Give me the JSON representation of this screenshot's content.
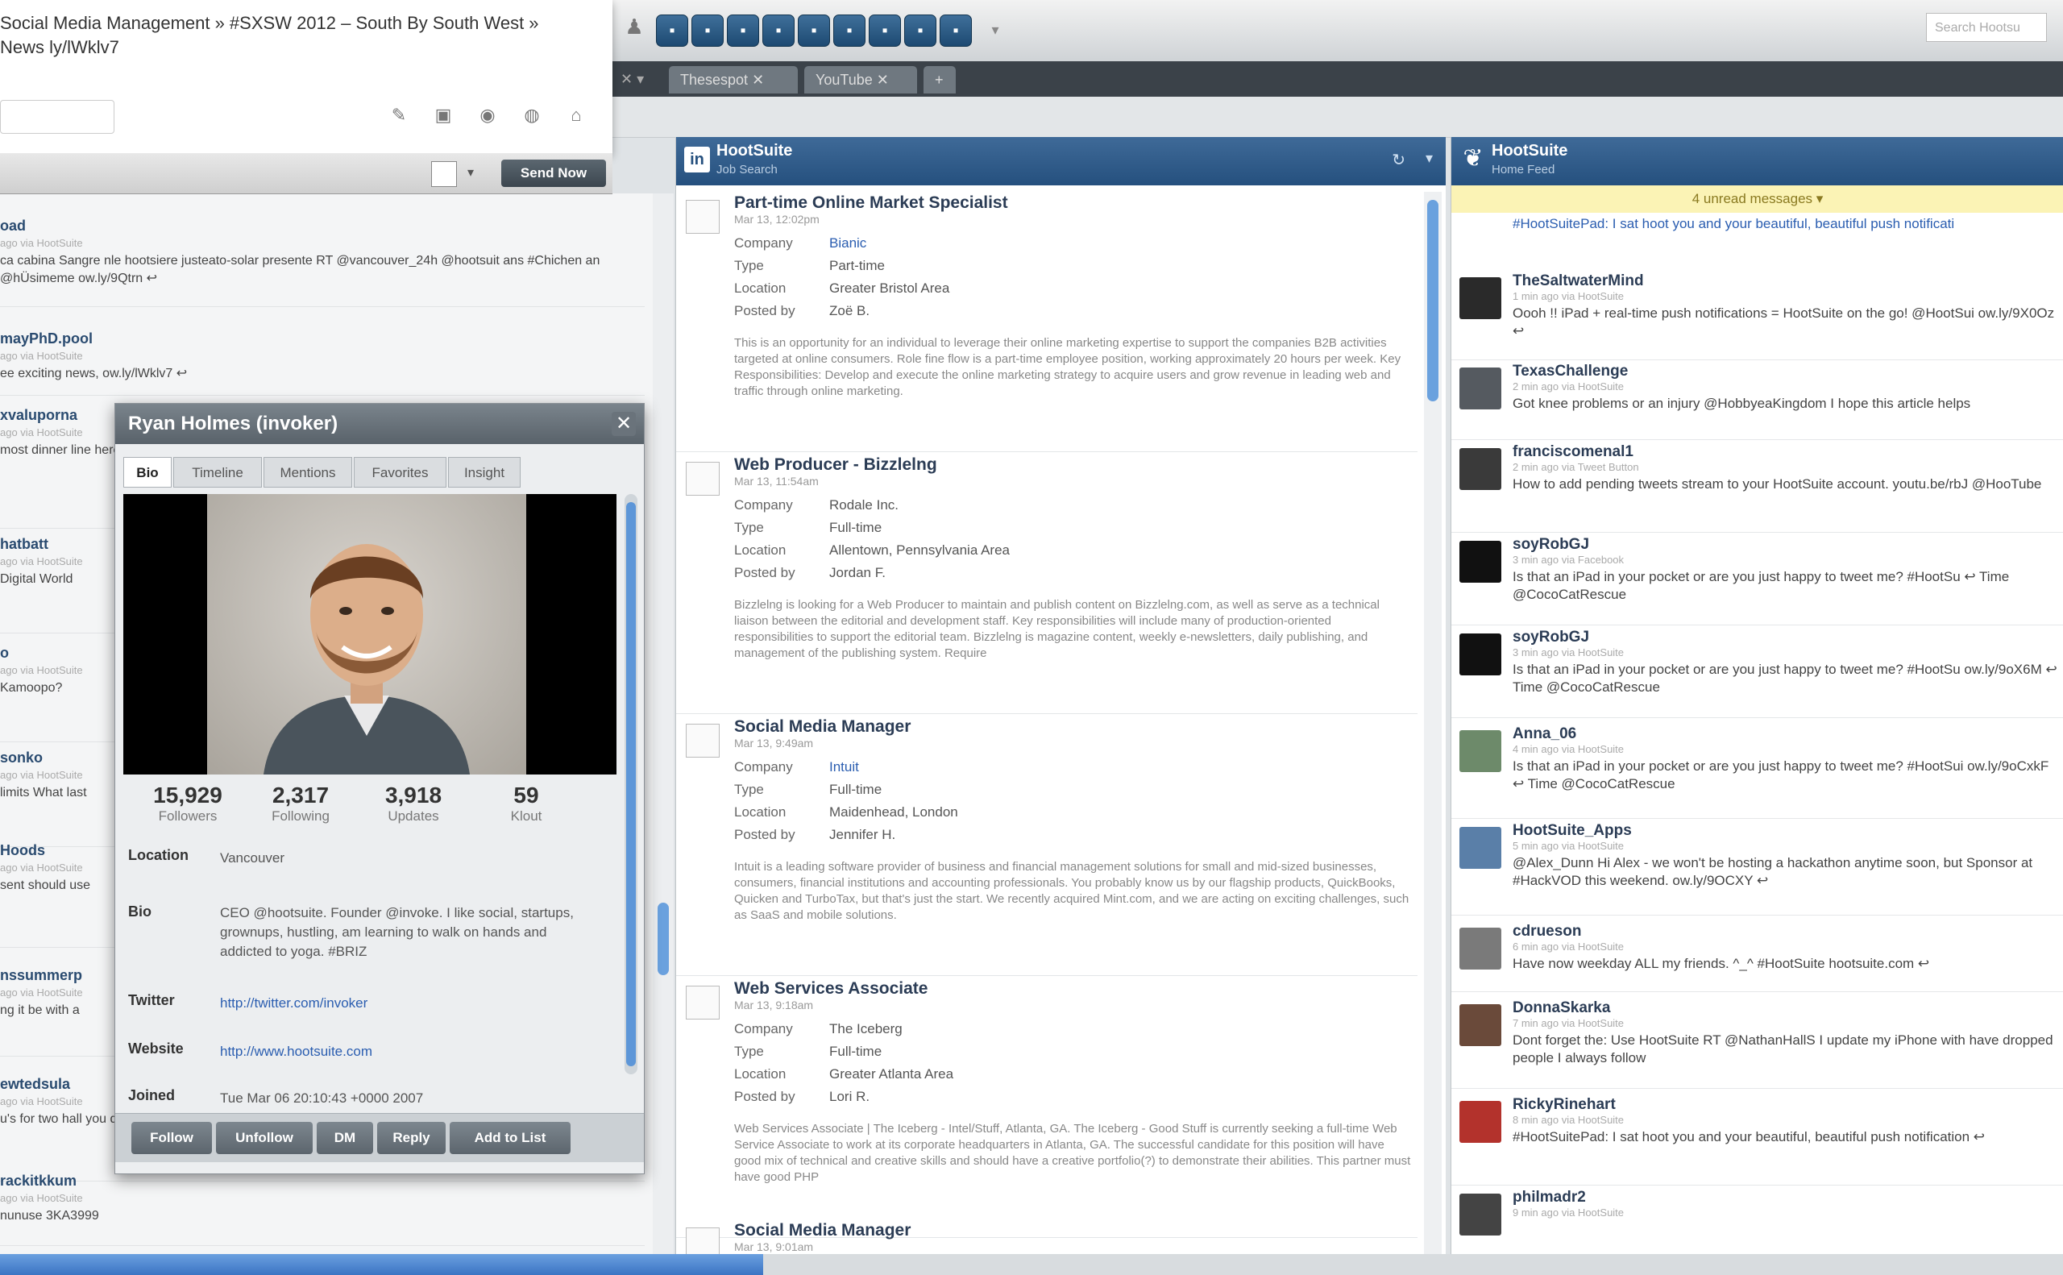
{
  "compose": {
    "text": "Social Media Management » #SXSW 2012 – South By South West » News ly/lWklv7",
    "send_now": "Send Now",
    "icons": [
      "paperclip-icon",
      "picture-icon",
      "location-icon",
      "globe-icon",
      "lock-icon"
    ]
  },
  "toolbar": {
    "search_placeholder": "Search Hootsu",
    "tabs": [
      {
        "label": "Thesespot"
      },
      {
        "label": "YouTube"
      }
    ]
  },
  "left_stream": {
    "tweets": [
      {
        "user": "oad",
        "meta": "ago via HootSuite",
        "text": "ca cabina Sangre nle hootsiere justeato-solar presente RT @vancouver_24h @hootsuit ans #Chichen an @hÜsimeme ow.ly/9Qtrn ↩"
      },
      {
        "user": "mayPhD.pool",
        "meta": "ago via HootSuite",
        "text": "ee exciting news, ow.ly/lWklv7 ↩"
      },
      {
        "user": "xvaluporna",
        "meta": "ago via HootSuite",
        "text": "most dinner line here"
      },
      {
        "user": "hatbatt",
        "meta": "ago via HootSuite",
        "text": "Digital World"
      },
      {
        "user": "o",
        "meta": "ago via HootSuite",
        "text": "Kamoopo?"
      },
      {
        "user": "sonko",
        "meta": "ago via HootSuite",
        "text": "limits What last"
      },
      {
        "user": "Hoods",
        "meta": "ago via HootSuite",
        "text": "sent should use"
      },
      {
        "user": "nssummerp",
        "meta": "ago via HootSuite",
        "text": "ng it be with a"
      },
      {
        "user": "ewtedsula",
        "meta": "ago via HootSuite",
        "text": "u's for two hall you don't see"
      },
      {
        "user": "rackitkkum",
        "meta": "ago via HootSuite",
        "text": "nunuse 3KA3999"
      }
    ]
  },
  "profile": {
    "name": "Ryan Holmes (invoker)",
    "tabs": [
      "Bio",
      "Timeline",
      "Mentions",
      "Favorites",
      "Insight"
    ],
    "stats": [
      {
        "value": "15,929",
        "label": "Followers"
      },
      {
        "value": "2,317",
        "label": "Following"
      },
      {
        "value": "3,918",
        "label": "Updates"
      },
      {
        "value": "59",
        "label": "Klout"
      }
    ],
    "location_label": "Location",
    "location": "Vancouver",
    "bio_label": "Bio",
    "bio": "CEO @hootsuite. Founder @invoke. I like social, startups, grownups, hustling, am learning to walk on hands and addicted to yoga. #BRIZ",
    "twitter_label": "Twitter",
    "twitter": "http://twitter.com/invoker",
    "website_label": "Website",
    "website": "http://www.hootsuite.com",
    "joined_label": "Joined",
    "joined": "Tue Mar 06 20:10:43 +0000 2007",
    "buttons": [
      "Follow",
      "Unfollow",
      "DM",
      "Reply",
      "Add to List"
    ]
  },
  "mid_stream": {
    "title": "HootSuite",
    "subtitle": "Job Search",
    "jobs": [
      {
        "title": "Part-time Online Market Specialist",
        "date": "Mar 13, 12:02pm",
        "company": "Bianic",
        "type": "Part-time",
        "location": "Greater Bristol Area",
        "posted_by": "Zoë B.",
        "desc": "This is an opportunity for an individual to leverage their online marketing expertise to support the companies B2B activities targeted at online consumers. Role fine flow is a part-time employee position, working approximately 20 hours per week. Key Responsibilities: Develop and execute the online marketing strategy to acquire users and grow revenue in leading web and traffic through online marketing."
      },
      {
        "title": "Web Producer - Bizzlelng",
        "date": "Mar 13, 11:54am",
        "company": "Rodale Inc.",
        "type": "Full-time",
        "location": "Allentown, Pennsylvania Area",
        "posted_by": "Jordan F.",
        "desc": "Bizzlelng is looking for a Web Producer to maintain and publish content on Bizzlelng.com, as well as serve as a technical liaison between the editorial and development staff. Key responsibilities will include many of production-oriented responsibilities to support the editorial team. Bizzlelng is magazine content, weekly e-newsletters, daily publishing, and management of the publishing system. Require"
      },
      {
        "title": "Social Media Manager",
        "date": "Mar 13, 9:49am",
        "company": "Intuit",
        "type": "Full-time",
        "location": "Maidenhead, London",
        "posted_by": "Jennifer H.",
        "desc": "Intuit is a leading software provider of business and financial management solutions for small and mid-sized businesses, consumers, financial institutions and accounting professionals. You probably know us by our flagship products, QuickBooks, Quicken and TurboTax, but that's just the start. We recently acquired Mint.com, and we are acting on exciting challenges, such as SaaS and mobile solutions."
      },
      {
        "title": "Web Services Associate",
        "date": "Mar 13, 9:18am",
        "company": "The Iceberg",
        "type": "Full-time",
        "location": "Greater Atlanta Area",
        "posted_by": "Lori R.",
        "desc": "Web Services Associate | The Iceberg - Intel/Stuff, Atlanta, GA. The Iceberg - Good Stuff is currently seeking a full-time Web Service Associate to work at its corporate headquarters in Atlanta, GA. The successful candidate for this position will have good mix of technical and creative skills and should have a creative portfolio(?) to demonstrate their abilities. This partner must have good PHP"
      },
      {
        "title": "Social Media Manager",
        "date": "Mar 13, 9:01am",
        "company": "",
        "type": "",
        "location": "",
        "posted_by": "",
        "desc": ""
      }
    ],
    "labels": {
      "company": "Company",
      "type": "Type",
      "location": "Location",
      "posted_by": "Posted by"
    }
  },
  "right_stream": {
    "title": "HootSuite",
    "subtitle": "Home Feed",
    "unread": "4 unread messages ▾",
    "first_text": "#HootSuitePad: I sat hoot you and your beautiful, beautiful push notificati",
    "tweets": [
      {
        "user": "TheSaltwaterMind",
        "meta": "1 min ago via HootSuite",
        "text": "Oooh !! iPad + real-time push notifications = HootSuite on the go! @HootSui ow.ly/9X0Oz ↩",
        "avatar": "#2a2a2a"
      },
      {
        "user": "TexasChallenge",
        "meta": "2 min ago via HootSuite",
        "text": "Got knee problems or an injury @HobbyeaKingdom I hope this article helps",
        "avatar": "#555a60"
      },
      {
        "user": "franciscomenal1",
        "meta": "2 min ago via Tweet Button",
        "text": "How to add pending tweets stream to your HootSuite account. youtu.be/rbJ @HooTube",
        "avatar": "#3a3a3a"
      },
      {
        "user": "soyRobGJ",
        "meta": "3 min ago via Facebook",
        "text": "Is that an iPad in your pocket or are you just happy to tweet me? #HootSu ↩ Time @CocoCatRescue",
        "avatar": "#111111"
      },
      {
        "user": "soyRobGJ",
        "meta": "3 min ago via HootSuite",
        "text": "Is that an iPad in your pocket or are you just happy to tweet me? #HootSu ow.ly/9oX6M ↩ Time @CocoCatRescue",
        "avatar": "#111111"
      },
      {
        "user": "Anna_06",
        "meta": "4 min ago via HootSuite",
        "text": "Is that an iPad in your pocket or are you just happy to tweet me? #HootSui ow.ly/9oCxkF ↩ Time @CocoCatRescue",
        "avatar": "#6d8a6a"
      },
      {
        "user": "HootSuite_Apps",
        "meta": "5 min ago via HootSuite",
        "text": "@Alex_Dunn Hi Alex - we won't be hosting a hackathon anytime soon, but Sponsor at #HackVOD this weekend. ow.ly/9OCXY ↩",
        "avatar": "#5a7fa8"
      },
      {
        "user": "cdrueson",
        "meta": "6 min ago via HootSuite",
        "text": "Have now weekday ALL my friends. ^_^ #HootSuite hootsuite.com ↩",
        "avatar": "#7a7a7a"
      },
      {
        "user": "DonnaSkarka",
        "meta": "7 min ago via HootSuite",
        "text": "Dont forget the: Use HootSuite RT @NathanHallS I update my iPhone with have dropped people I always follow",
        "avatar": "#6a4a3a"
      },
      {
        "user": "RickyRinehart",
        "meta": "8 min ago via HootSuite",
        "text": "#HootSuitePad: I sat hoot you and your beautiful, beautiful push notification ↩",
        "avatar": "#b3322c"
      },
      {
        "user": "philmadr2",
        "meta": "9 min ago via HootSuite",
        "text": "",
        "avatar": "#444444"
      }
    ]
  },
  "progress": 0.37
}
